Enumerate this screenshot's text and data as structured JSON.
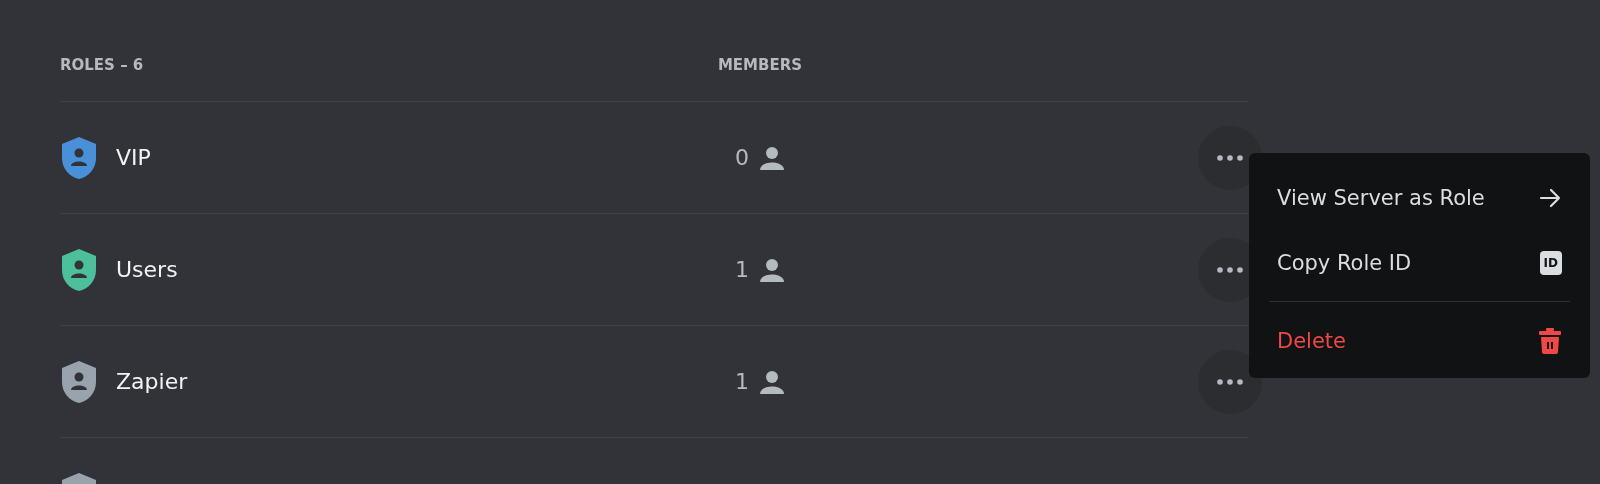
{
  "table": {
    "title": "ROLES – 6",
    "members_heading": "MEMBERS",
    "rows": [
      {
        "name": "VIP",
        "members": "0",
        "color": "#4a90d9"
      },
      {
        "name": "Users",
        "members": "1",
        "color": "#4dbf9a"
      },
      {
        "name": "Zapier",
        "members": "1",
        "color": "#99a3ad"
      },
      {
        "color": "#99a3ad"
      }
    ]
  },
  "context_menu": {
    "items": [
      {
        "label": "View Server as Role",
        "kind": "arrow"
      },
      {
        "label": "Copy Role ID",
        "kind": "id",
        "badge": "ID"
      },
      {
        "kind": "separator"
      },
      {
        "label": "Delete",
        "kind": "danger"
      }
    ]
  }
}
